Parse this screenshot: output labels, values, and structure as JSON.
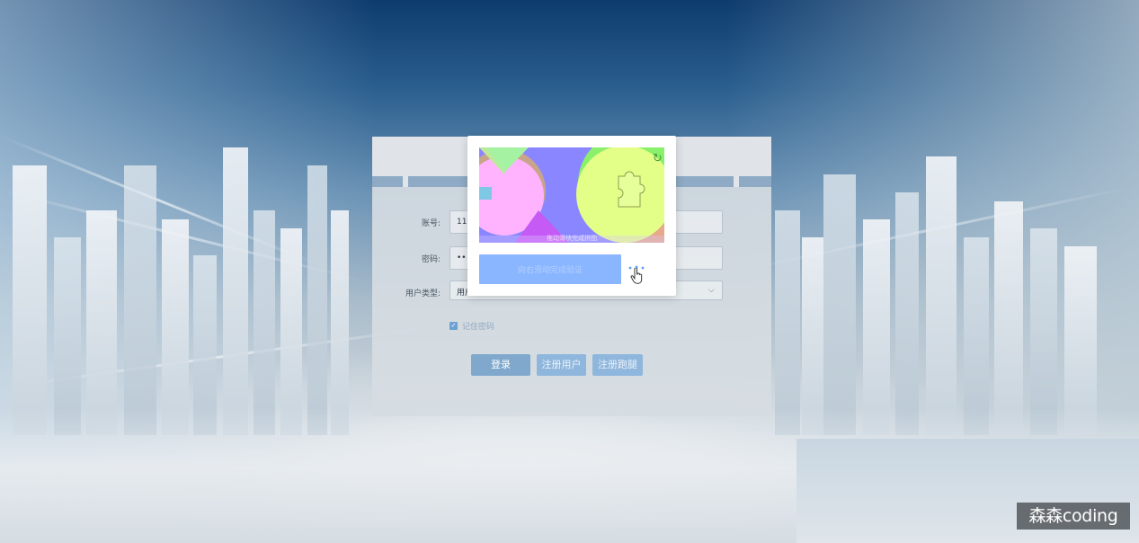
{
  "login_form": {
    "account_label": "账号:",
    "account_value": "111",
    "password_label": "密码:",
    "password_value": "•••",
    "user_type_label": "用户类型:",
    "user_type_value": "用户",
    "remember_label": "记住密码",
    "remember_checked": true,
    "login_button": "登录",
    "register_user_button": "注册用户",
    "register_coach_button": "注册跑腿"
  },
  "captcha": {
    "caption": "拖动滑块完成拼图",
    "slider_hint": "向右滑动完成验证",
    "icons": [
      "refresh-icon",
      "puzzle-piece-icon",
      "slider-dots-icon",
      "hand-pointer-icon"
    ]
  },
  "watermark": {
    "text": "森森coding"
  },
  "colors": {
    "slider_track": "#8ab6ff",
    "primary_button": "#7fa8cc",
    "secondary_button": "#8fb6dc",
    "checkbox": "#6da1d3"
  }
}
